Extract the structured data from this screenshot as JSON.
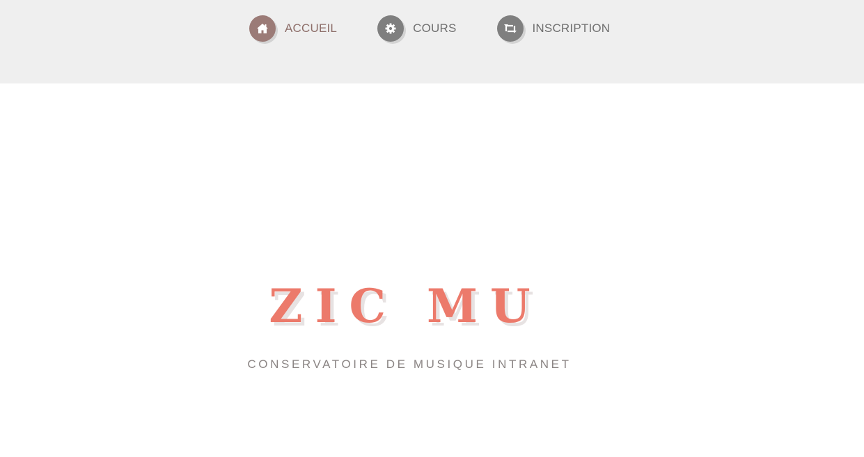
{
  "nav": {
    "items": [
      {
        "label": "ACCUEIL",
        "icon": "home-icon",
        "color": "#9b7b77",
        "active": true
      },
      {
        "label": "COURS",
        "icon": "gear-icon",
        "color": "#7f7f7f",
        "active": false
      },
      {
        "label": "INSCRIPTION",
        "icon": "retweet-icon",
        "color": "#7f7f7f",
        "active": false
      }
    ]
  },
  "hero": {
    "title": "ZIC MU",
    "subtitle": "CONSERVATOIRE DE MUSIQUE INTRANET"
  },
  "colors": {
    "topbar_bg": "#efefef",
    "title_color": "#ec7a6b",
    "subtitle_color": "#8b8584"
  }
}
